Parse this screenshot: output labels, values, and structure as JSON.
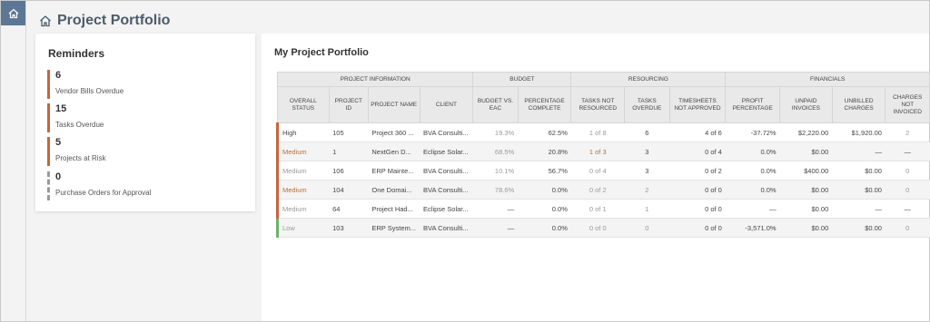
{
  "header": {
    "title": "Project Portfolio"
  },
  "reminders": {
    "title": "Reminders",
    "items": [
      {
        "count": "6",
        "label": "Vendor Bills Overdue"
      },
      {
        "count": "15",
        "label": "Tasks Overdue"
      },
      {
        "count": "5",
        "label": "Projects at Risk"
      },
      {
        "count": "0",
        "label": "Purchase Orders for Approval"
      }
    ]
  },
  "portfolio": {
    "title": "My Project Portfolio",
    "groups": [
      "PROJECT INFORMATION",
      "BUDGET",
      "RESOURCING",
      "FINANCIALS"
    ],
    "columns": [
      "OVERALL STATUS",
      "PROJECT ID",
      "PROJECT NAME",
      "CLIENT",
      "BUDGET VS. EAC",
      "PERCENTAGE COMPLETE",
      "TASKS NOT RESOURCED",
      "TASKS OVERDUE",
      "TIMESHEETS NOT APPROVED",
      "PROFIT PERCENTAGE",
      "UNPAID INVOICES",
      "UNBILLED CHARGES",
      "CHARGES NOT INVOICED"
    ],
    "rows": [
      {
        "status": "High",
        "id": "105",
        "name": "Project 360 ...",
        "client": "BVA Consulti...",
        "budget_eac": "19.3%",
        "pct_complete": "62.5%",
        "tasks_not_resourced": "1 of 8",
        "tasks_overdue": "6",
        "timesheets": "4 of 6",
        "profit": "-37.72%",
        "unpaid": "$2,220.00",
        "unbilled": "$1,920.00",
        "not_invoiced": "2"
      },
      {
        "status": "Medium",
        "id": "1",
        "name": "NextGen D...",
        "client": "Eclipse Solar...",
        "budget_eac": "68.5%",
        "pct_complete": "20.8%",
        "tasks_not_resourced": "1 of 3",
        "tasks_overdue": "3",
        "timesheets": "0 of 4",
        "profit": "0.0%",
        "unpaid": "$0.00",
        "unbilled": "—",
        "not_invoiced": "—"
      },
      {
        "status": "Medium",
        "id": "106",
        "name": "ERP Mainte...",
        "client": "BVA Consulti...",
        "budget_eac": "10.1%",
        "pct_complete": "56.7%",
        "tasks_not_resourced": "0 of 4",
        "tasks_overdue": "3",
        "timesheets": "0 of 2",
        "profit": "0.0%",
        "unpaid": "$400.00",
        "unbilled": "$0.00",
        "not_invoiced": "0"
      },
      {
        "status": "Medium",
        "id": "104",
        "name": "One Domai...",
        "client": "BVA Consulti...",
        "budget_eac": "78.6%",
        "pct_complete": "0.0%",
        "tasks_not_resourced": "0 of 2",
        "tasks_overdue": "2",
        "timesheets": "0 of 0",
        "profit": "0.0%",
        "unpaid": "$0.00",
        "unbilled": "$0.00",
        "not_invoiced": "0"
      },
      {
        "status": "Medium",
        "id": "64",
        "name": "Project Had...",
        "client": "Eclipse Solar...",
        "budget_eac": "—",
        "pct_complete": "0.0%",
        "tasks_not_resourced": "0 of 1",
        "tasks_overdue": "1",
        "timesheets": "0 of 0",
        "profit": "—",
        "unpaid": "$0.00",
        "unbilled": "—",
        "not_invoiced": "—"
      },
      {
        "status": "Low",
        "id": "103",
        "name": "ERP System...",
        "client": "BVA Consulti...",
        "budget_eac": "—",
        "pct_complete": "0.0%",
        "tasks_not_resourced": "0 of 0",
        "tasks_overdue": "0",
        "timesheets": "0 of 0",
        "profit": "-3,571.0%",
        "unpaid": "$0.00",
        "unbilled": "$0.00",
        "not_invoiced": "0"
      }
    ]
  },
  "colors": {
    "accent": "#5c7796",
    "high": "#c8643c",
    "low": "#6fb06b"
  },
  "icons": {
    "nav_home": "home-icon",
    "title": "home-outline-icon"
  }
}
